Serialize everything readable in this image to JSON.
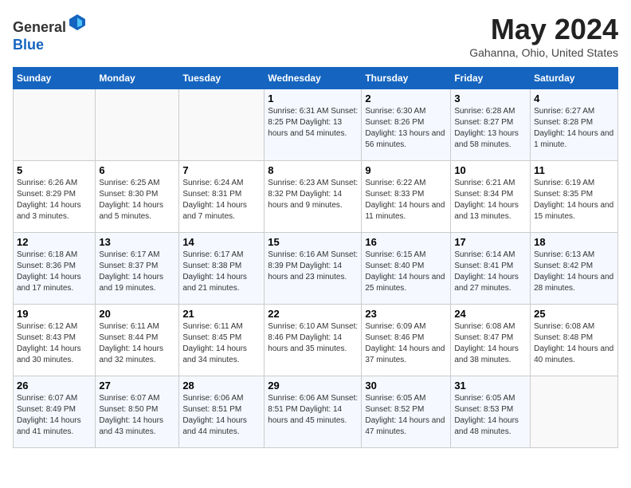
{
  "header": {
    "logo_general": "General",
    "logo_blue": "Blue",
    "month_year": "May 2024",
    "location": "Gahanna, Ohio, United States"
  },
  "calendar": {
    "weekdays": [
      "Sunday",
      "Monday",
      "Tuesday",
      "Wednesday",
      "Thursday",
      "Friday",
      "Saturday"
    ],
    "weeks": [
      [
        {
          "day": "",
          "content": ""
        },
        {
          "day": "",
          "content": ""
        },
        {
          "day": "",
          "content": ""
        },
        {
          "day": "1",
          "content": "Sunrise: 6:31 AM\nSunset: 8:25 PM\nDaylight: 13 hours\nand 54 minutes."
        },
        {
          "day": "2",
          "content": "Sunrise: 6:30 AM\nSunset: 8:26 PM\nDaylight: 13 hours\nand 56 minutes."
        },
        {
          "day": "3",
          "content": "Sunrise: 6:28 AM\nSunset: 8:27 PM\nDaylight: 13 hours\nand 58 minutes."
        },
        {
          "day": "4",
          "content": "Sunrise: 6:27 AM\nSunset: 8:28 PM\nDaylight: 14 hours\nand 1 minute."
        }
      ],
      [
        {
          "day": "5",
          "content": "Sunrise: 6:26 AM\nSunset: 8:29 PM\nDaylight: 14 hours\nand 3 minutes."
        },
        {
          "day": "6",
          "content": "Sunrise: 6:25 AM\nSunset: 8:30 PM\nDaylight: 14 hours\nand 5 minutes."
        },
        {
          "day": "7",
          "content": "Sunrise: 6:24 AM\nSunset: 8:31 PM\nDaylight: 14 hours\nand 7 minutes."
        },
        {
          "day": "8",
          "content": "Sunrise: 6:23 AM\nSunset: 8:32 PM\nDaylight: 14 hours\nand 9 minutes."
        },
        {
          "day": "9",
          "content": "Sunrise: 6:22 AM\nSunset: 8:33 PM\nDaylight: 14 hours\nand 11 minutes."
        },
        {
          "day": "10",
          "content": "Sunrise: 6:21 AM\nSunset: 8:34 PM\nDaylight: 14 hours\nand 13 minutes."
        },
        {
          "day": "11",
          "content": "Sunrise: 6:19 AM\nSunset: 8:35 PM\nDaylight: 14 hours\nand 15 minutes."
        }
      ],
      [
        {
          "day": "12",
          "content": "Sunrise: 6:18 AM\nSunset: 8:36 PM\nDaylight: 14 hours\nand 17 minutes."
        },
        {
          "day": "13",
          "content": "Sunrise: 6:17 AM\nSunset: 8:37 PM\nDaylight: 14 hours\nand 19 minutes."
        },
        {
          "day": "14",
          "content": "Sunrise: 6:17 AM\nSunset: 8:38 PM\nDaylight: 14 hours\nand 21 minutes."
        },
        {
          "day": "15",
          "content": "Sunrise: 6:16 AM\nSunset: 8:39 PM\nDaylight: 14 hours\nand 23 minutes."
        },
        {
          "day": "16",
          "content": "Sunrise: 6:15 AM\nSunset: 8:40 PM\nDaylight: 14 hours\nand 25 minutes."
        },
        {
          "day": "17",
          "content": "Sunrise: 6:14 AM\nSunset: 8:41 PM\nDaylight: 14 hours\nand 27 minutes."
        },
        {
          "day": "18",
          "content": "Sunrise: 6:13 AM\nSunset: 8:42 PM\nDaylight: 14 hours\nand 28 minutes."
        }
      ],
      [
        {
          "day": "19",
          "content": "Sunrise: 6:12 AM\nSunset: 8:43 PM\nDaylight: 14 hours\nand 30 minutes."
        },
        {
          "day": "20",
          "content": "Sunrise: 6:11 AM\nSunset: 8:44 PM\nDaylight: 14 hours\nand 32 minutes."
        },
        {
          "day": "21",
          "content": "Sunrise: 6:11 AM\nSunset: 8:45 PM\nDaylight: 14 hours\nand 34 minutes."
        },
        {
          "day": "22",
          "content": "Sunrise: 6:10 AM\nSunset: 8:46 PM\nDaylight: 14 hours\nand 35 minutes."
        },
        {
          "day": "23",
          "content": "Sunrise: 6:09 AM\nSunset: 8:46 PM\nDaylight: 14 hours\nand 37 minutes."
        },
        {
          "day": "24",
          "content": "Sunrise: 6:08 AM\nSunset: 8:47 PM\nDaylight: 14 hours\nand 38 minutes."
        },
        {
          "day": "25",
          "content": "Sunrise: 6:08 AM\nSunset: 8:48 PM\nDaylight: 14 hours\nand 40 minutes."
        }
      ],
      [
        {
          "day": "26",
          "content": "Sunrise: 6:07 AM\nSunset: 8:49 PM\nDaylight: 14 hours\nand 41 minutes."
        },
        {
          "day": "27",
          "content": "Sunrise: 6:07 AM\nSunset: 8:50 PM\nDaylight: 14 hours\nand 43 minutes."
        },
        {
          "day": "28",
          "content": "Sunrise: 6:06 AM\nSunset: 8:51 PM\nDaylight: 14 hours\nand 44 minutes."
        },
        {
          "day": "29",
          "content": "Sunrise: 6:06 AM\nSunset: 8:51 PM\nDaylight: 14 hours\nand 45 minutes."
        },
        {
          "day": "30",
          "content": "Sunrise: 6:05 AM\nSunset: 8:52 PM\nDaylight: 14 hours\nand 47 minutes."
        },
        {
          "day": "31",
          "content": "Sunrise: 6:05 AM\nSunset: 8:53 PM\nDaylight: 14 hours\nand 48 minutes."
        },
        {
          "day": "",
          "content": ""
        }
      ]
    ]
  }
}
